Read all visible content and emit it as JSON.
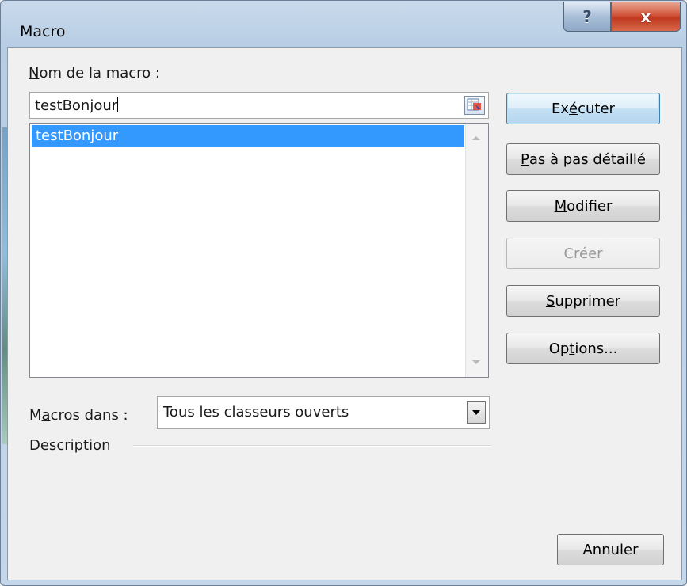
{
  "window": {
    "title": "Macro",
    "help_label": "?",
    "close_label": "x"
  },
  "macro_name": {
    "label_accel": "N",
    "label_rest": "om de la macro :",
    "value": "testBonjour"
  },
  "macro_list": {
    "items": [
      "testBonjour"
    ],
    "selected_index": 0
  },
  "buttons": {
    "run": {
      "before": "Ex",
      "accel": "é",
      "after": "cuter"
    },
    "step": {
      "before": "",
      "accel": "P",
      "after": "as à pas détaillé"
    },
    "edit": {
      "before": "",
      "accel": "M",
      "after": "odifier"
    },
    "create": {
      "label": "Créer",
      "enabled": false
    },
    "delete": {
      "before": "",
      "accel": "S",
      "after": "upprimer"
    },
    "options": {
      "before": "Op",
      "accel": "t",
      "after": "ions..."
    },
    "cancel": {
      "label": "Annuler"
    }
  },
  "macros_in": {
    "label_before": "M",
    "label_accel": "a",
    "label_after": "cros dans :",
    "value": "Tous les classeurs ouverts"
  },
  "description": {
    "label": "Description"
  },
  "colors": {
    "selection": "#3399ff",
    "default_button_border": "#3c7fb1",
    "close_button": "#c7412a"
  }
}
